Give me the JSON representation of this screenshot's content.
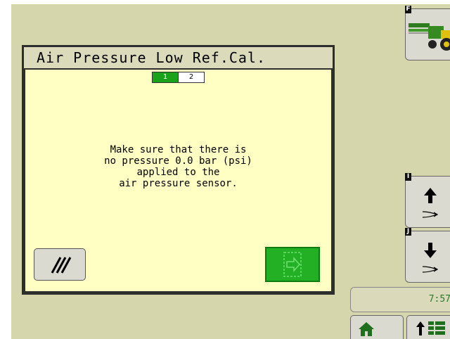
{
  "dialog": {
    "title": "Air Pressure Low Ref.Cal.",
    "steps": [
      "1",
      "2"
    ],
    "message": "Make sure that there is\nno pressure 0.0 bar (psi)\napplied to the\nair pressure sensor."
  },
  "sidebar": {
    "machine_badge": "F",
    "raise_badge": "I",
    "lower_badge": "J"
  },
  "status": {
    "clock": "7:57"
  },
  "colors": {
    "background": "#d6d6ac",
    "dialog_body": "#ffffc4",
    "accent_green": "#24b024"
  }
}
